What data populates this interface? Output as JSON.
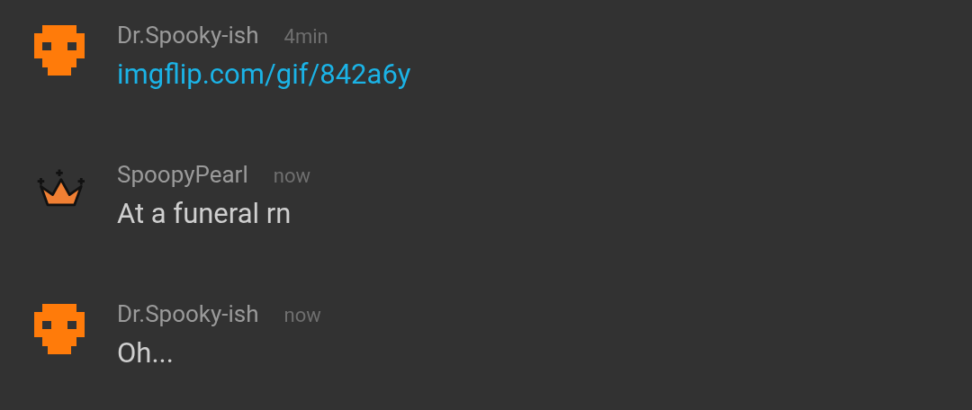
{
  "messages": [
    {
      "avatar": {
        "kind": "skull"
      },
      "author": "Dr.Spooky-ish",
      "time": "4min",
      "kind": "link",
      "text": "imgflip.com/gif/842a6y"
    },
    {
      "avatar": {
        "kind": "crown"
      },
      "author": "SpoopyPearl",
      "time": "now",
      "kind": "text",
      "text": "At a funeral rn"
    },
    {
      "avatar": {
        "kind": "skull"
      },
      "author": "Dr.Spooky-ish",
      "time": "now",
      "kind": "text",
      "text": "Oh..."
    }
  ]
}
